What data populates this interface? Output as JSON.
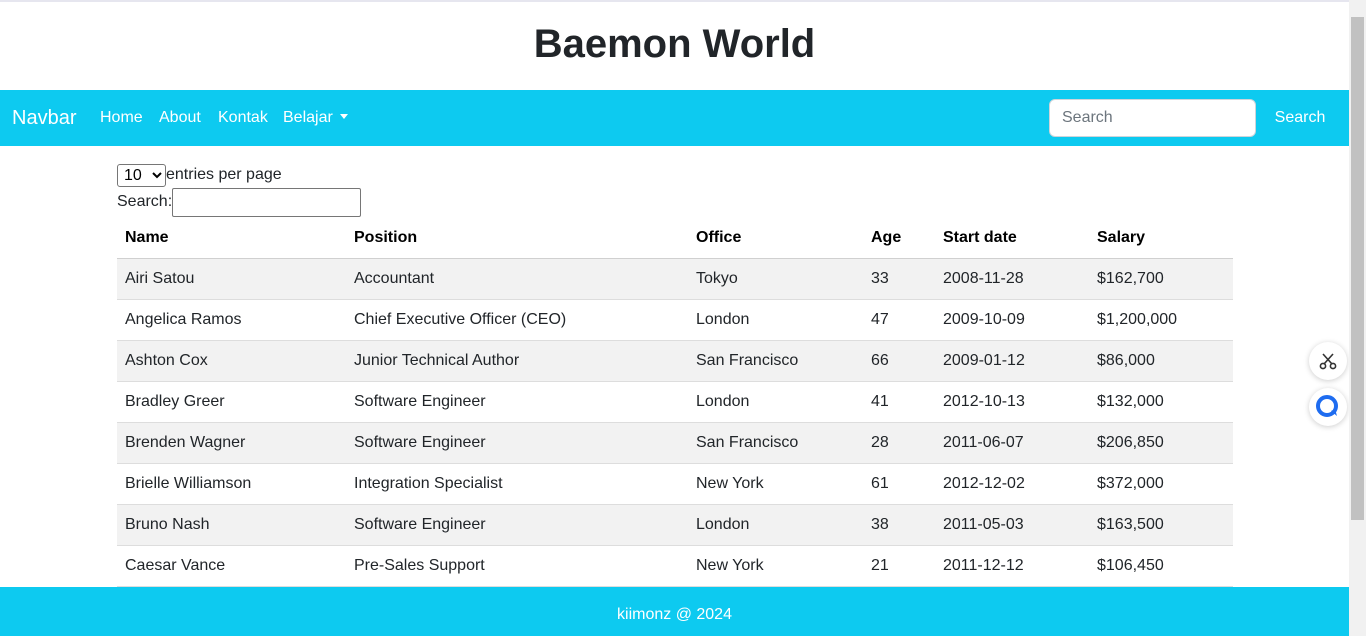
{
  "site_title": "Baemon World",
  "navbar": {
    "brand": "Navbar",
    "links": [
      "Home",
      "About",
      "Kontak",
      "Belajar"
    ],
    "search_placeholder": "Search",
    "search_button": "Search"
  },
  "datatable": {
    "entries_value": "10",
    "entries_label": "entries per page",
    "search_label": "Search:",
    "columns": [
      "Name",
      "Position",
      "Office",
      "Age",
      "Start date",
      "Salary"
    ],
    "rows": [
      [
        "Airi Satou",
        "Accountant",
        "Tokyo",
        "33",
        "2008-11-28",
        "$162,700"
      ],
      [
        "Angelica Ramos",
        "Chief Executive Officer (CEO)",
        "London",
        "47",
        "2009-10-09",
        "$1,200,000"
      ],
      [
        "Ashton Cox",
        "Junior Technical Author",
        "San Francisco",
        "66",
        "2009-01-12",
        "$86,000"
      ],
      [
        "Bradley Greer",
        "Software Engineer",
        "London",
        "41",
        "2012-10-13",
        "$132,000"
      ],
      [
        "Brenden Wagner",
        "Software Engineer",
        "San Francisco",
        "28",
        "2011-06-07",
        "$206,850"
      ],
      [
        "Brielle Williamson",
        "Integration Specialist",
        "New York",
        "61",
        "2012-12-02",
        "$372,000"
      ],
      [
        "Bruno Nash",
        "Software Engineer",
        "London",
        "38",
        "2011-05-03",
        "$163,500"
      ],
      [
        "Caesar Vance",
        "Pre-Sales Support",
        "New York",
        "21",
        "2011-12-12",
        "$106,450"
      ]
    ]
  },
  "footer": {
    "text": "kiimonz @ 2024"
  },
  "floating": {
    "icons": [
      "scissors-icon",
      "chat-icon"
    ]
  },
  "colors": {
    "accent": "#0dcaf0",
    "stripe": "#f2f2f2"
  }
}
